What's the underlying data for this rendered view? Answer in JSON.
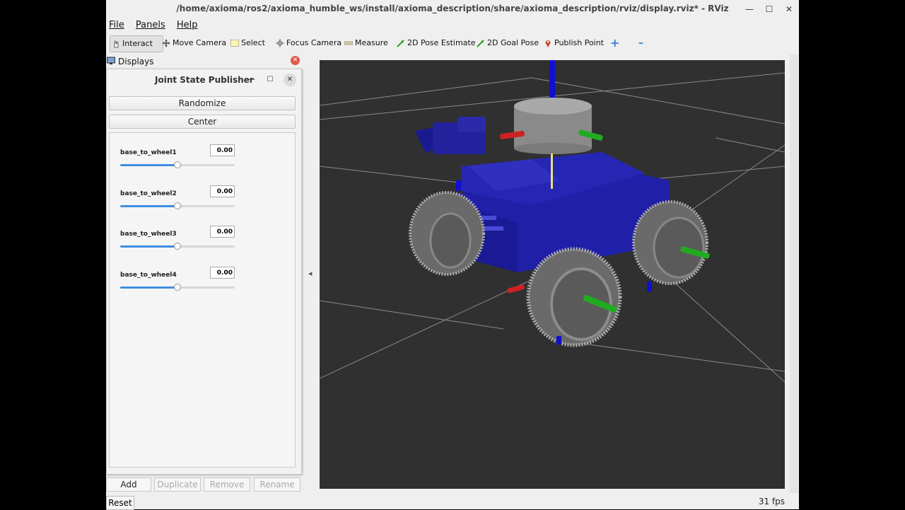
{
  "window": {
    "title": "/home/axioma/ros2/axioma_humble_ws/install/axioma_description/share/axioma_description/rviz/display.rviz* - RViz",
    "minimize": "—",
    "maximize": "☐",
    "close": "✕"
  },
  "menu": [
    "File",
    "Panels",
    "Help"
  ],
  "toolbar": {
    "interact": "Interact",
    "move_camera": "Move Camera",
    "select": "Select",
    "focus_camera": "Focus Camera",
    "measure": "Measure",
    "pose_estimate": "2D Pose Estimate",
    "goal_pose": "2D Goal Pose",
    "publish_point": "Publish Point",
    "plus": "+",
    "minus": "–"
  },
  "displays": {
    "title": "Displays"
  },
  "jsp": {
    "title": "Joint State Publisher",
    "randomize": "Randomize",
    "center": "Center",
    "joints": [
      {
        "name": "base_to_wheel1",
        "value": "0.00",
        "level": 0.5
      },
      {
        "name": "base_to_wheel2",
        "value": "0.00",
        "level": 0.5
      },
      {
        "name": "base_to_wheel3",
        "value": "0.00",
        "level": 0.5
      },
      {
        "name": "base_to_wheel4",
        "value": "0.00",
        "level": 0.5
      }
    ]
  },
  "bottom_buttons": {
    "add": "Add",
    "duplicate": "Duplicate",
    "remove": "Remove",
    "rename": "Rename"
  },
  "status": {
    "reset": "Reset",
    "fps": "31 fps"
  },
  "colors": {
    "robot": "#1f1fa8",
    "grid": "#8a8a8a",
    "viewport_bg": "#303030",
    "slider_fill": "#3f8ee0"
  }
}
